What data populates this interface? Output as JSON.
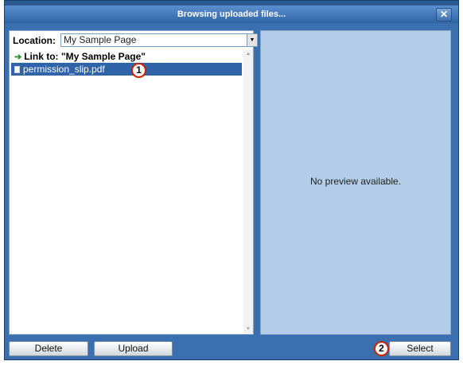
{
  "dialog": {
    "title": "Browsing uploaded files...",
    "close_label": "✕"
  },
  "location": {
    "label": "Location:",
    "value": "My Sample Page"
  },
  "file_list": {
    "link_item": "Link to: \"My Sample Page\"",
    "items": [
      {
        "name": "permission_slip.pdf",
        "selected": true
      }
    ]
  },
  "preview": {
    "message": "No preview available."
  },
  "buttons": {
    "delete": "Delete",
    "upload": "Upload",
    "select": "Select"
  },
  "callouts": {
    "first": "1",
    "second": "2"
  },
  "colors": {
    "dialog_blue": "#3a6fb0",
    "selection": "#2f64a8",
    "preview_bg": "#b3cde8",
    "callout_border": "#cc2200"
  }
}
